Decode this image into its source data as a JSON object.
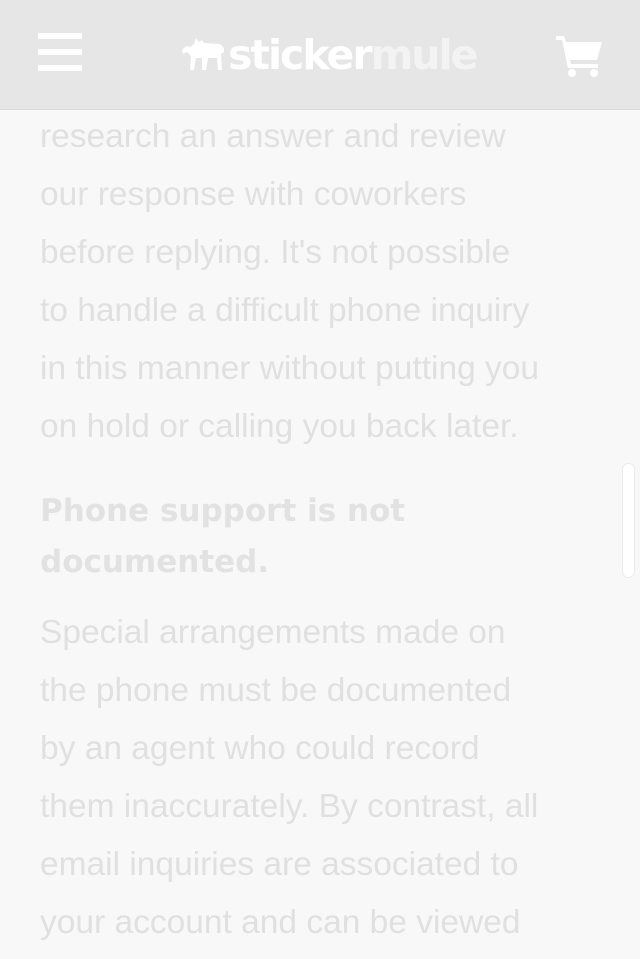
{
  "header": {
    "brand": {
      "part1": "sticker",
      "part2": "mule"
    },
    "icons": {
      "menu": "hamburger-menu-icon",
      "logo": "mule-logo-icon",
      "cart": "shopping-cart-icon"
    }
  },
  "content": {
    "intro_lines": [
      "research an answer and review",
      "our response with coworkers",
      "before replying. It's not possible",
      "to handle a difficult phone inquiry",
      "in this manner without putting you",
      "on hold or calling you back later."
    ],
    "heading_lines": [
      "Phone support is not",
      "documented."
    ],
    "body_lines": [
      "Special arrangements made on",
      "the phone must be documented",
      "by an agent who could record",
      "them inaccurately. By contrast, all",
      "email inquiries are associated to",
      "your account and can be viewed"
    ]
  },
  "colors": {
    "header_bg": "#e6e6e6",
    "page_bg": "#f8f8f8",
    "text": "#e0e0e0",
    "icon": "#ffffff"
  }
}
